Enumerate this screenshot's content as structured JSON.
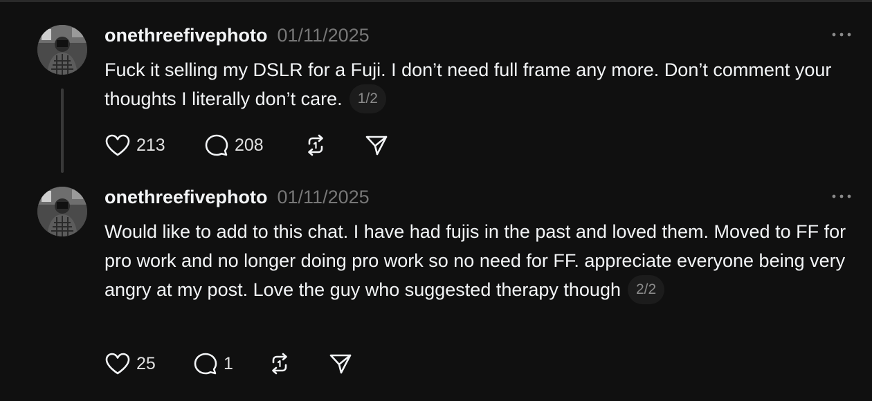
{
  "posts": [
    {
      "username": "onethreefivephoto",
      "timestamp": "01/11/2025",
      "text": "Fuck it selling my DSLR for a Fuji. I don’t need full frame any more. Don’t comment your thoughts I literally don’t care.",
      "page_badge": "1/2",
      "likes": "213",
      "replies": "208",
      "icons": [
        "heart-icon",
        "comment-icon",
        "repost-icon",
        "share-icon",
        "more-icon"
      ]
    },
    {
      "username": "onethreefivephoto",
      "timestamp": "01/11/2025",
      "text": "Would like to add to this chat. I have had fujis in the past and loved them. Moved to FF for pro work and no longer doing pro work so no need for FF. appreciate everyone being very angry at my post. Love the guy who suggested therapy though",
      "page_badge": "2/2",
      "likes": "25",
      "replies": "1",
      "icons": [
        "heart-icon",
        "comment-icon",
        "repost-icon",
        "share-icon",
        "more-icon"
      ]
    }
  ],
  "colors": {
    "background": "#101010",
    "text": "#f3f5f7",
    "muted": "#777777",
    "thread_line": "#383838",
    "badge_bg": "#1c1c1c"
  }
}
